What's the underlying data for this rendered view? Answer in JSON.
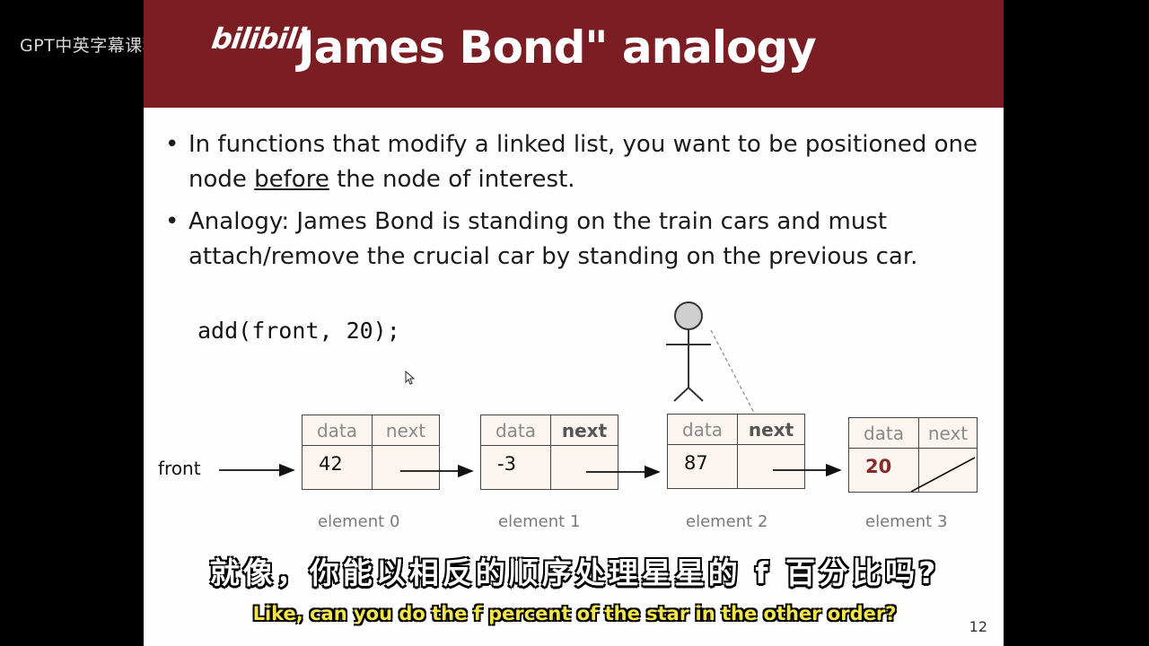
{
  "watermark": {
    "channel": "GPT中英字幕课程",
    "logo": "bilibili"
  },
  "slide": {
    "title": "\"James Bond\" analogy",
    "title_visible": "James Bond\" analogy",
    "bullets": [
      {
        "before": "In functions that modify a linked list, you want to be positioned one node ",
        "underlined": "before",
        "after": " the node of interest."
      },
      {
        "text": "Analogy: James Bond is standing on the train cars and must attach/remove the crucial car by standing on the previous car."
      }
    ],
    "code": "add(front, 20);",
    "front_label": "front",
    "nodes": [
      {
        "data_header": "data",
        "next_header": "next",
        "value": "42",
        "label": "element 0",
        "next_bold": false
      },
      {
        "data_header": "data",
        "next_header": "next",
        "value": "-3",
        "label": "element 1",
        "next_bold": true
      },
      {
        "data_header": "data",
        "next_header": "next",
        "value": "87",
        "label": "element 2",
        "next_bold": true
      },
      {
        "data_header": "data",
        "next_header": "next",
        "value": "20",
        "label": "element 3",
        "next_bold": false,
        "value_highlight": "#8b2a2a",
        "next_null": true
      }
    ],
    "page_number": "12",
    "colors": {
      "title_bar": "#7b1e24",
      "node_fill": "#fbf4ef"
    }
  },
  "subtitles": {
    "chinese": "就像，你能以相反的顺序处理星星的 f 百分比吗?",
    "english": "Like, can you do the f percent of the star in the other order?"
  }
}
